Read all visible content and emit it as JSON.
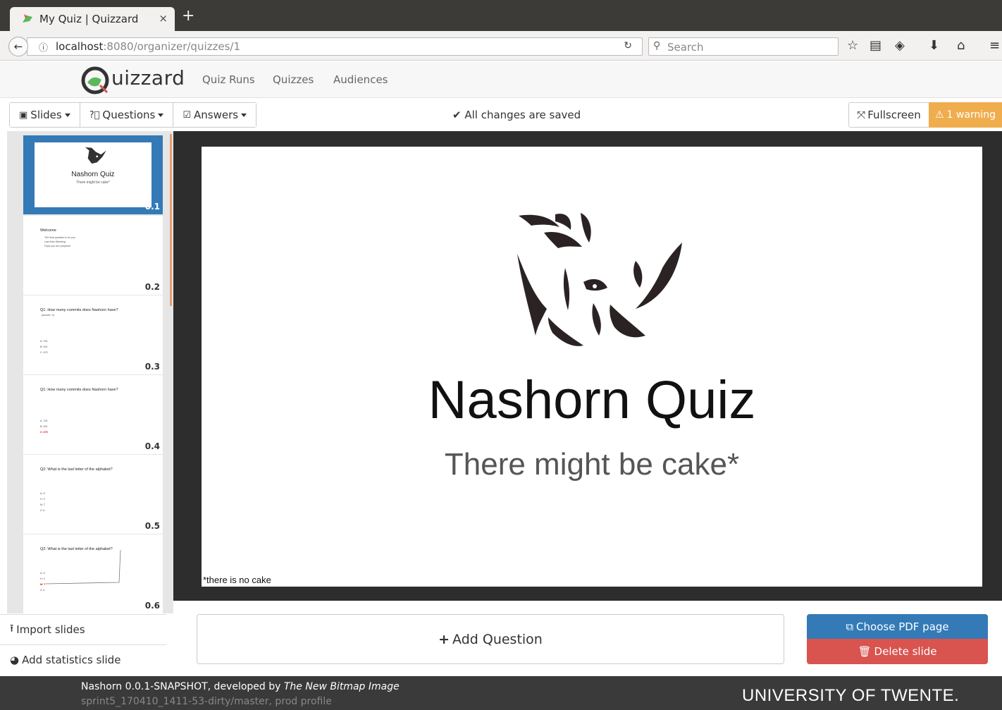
{
  "browser": {
    "tab_title": "My Quiz | Quizzard",
    "tab_close": "×",
    "new_tab": "+",
    "url_host": "localhost",
    "url_rest": ":8080/organizer/quizzes/1",
    "search_placeholder": "Search",
    "icons": [
      "back-icon",
      "info-icon",
      "reload-icon",
      "search-icon",
      "star-icon",
      "reading-list-icon",
      "pocket-icon",
      "download-icon",
      "home-icon",
      "menu-icon"
    ]
  },
  "header": {
    "logo_text": "uizzard",
    "nav": [
      "Quiz Runs",
      "Quizzes",
      "Audiences"
    ]
  },
  "toolbar": {
    "slides_label": "Slides",
    "questions_label": "Questions",
    "answers_label": "Answers",
    "saved_text": "All changes are saved",
    "fullscreen_label": "Fullscreen",
    "warning_label": "1 warning",
    "warning_color": "#f0ad4e"
  },
  "sidebar": {
    "slides": [
      {
        "num": "0.1",
        "title": "Nashorn Quiz",
        "sub": "There might be cake*",
        "active": true
      },
      {
        "num": "0.2",
        "title": "Welcome",
        "lines": [
          "The final question is for you",
          "Last Man Standing",
          "Hope you are prepared"
        ]
      },
      {
        "num": "0.3",
        "title": "Q1: How many commits does Nashorn have?",
        "hint": "(answer: 3)",
        "answers": [
          "A: 726",
          "B: 200",
          "C: 670"
        ]
      },
      {
        "num": "0.4",
        "title": "Q1: How many commits does Nashorn have?",
        "answers": [
          "A: 726",
          "B: 200",
          "C: 670"
        ],
        "correct": "C: 670"
      },
      {
        "num": "0.5",
        "title": "Q2: What is the last letter of the alphabet?",
        "answers": [
          "A: G",
          "H: C",
          "M: T",
          "Z: A"
        ]
      },
      {
        "num": "0.6",
        "title": "Q2: What is the last letter of the alphabet?",
        "answers": [
          "A: G",
          "H: C",
          "M: T",
          "Z: A"
        ],
        "correct": "M: T"
      }
    ],
    "import_label": "Import slides",
    "stats_label": "Add statistics slide"
  },
  "slide": {
    "title": "Nashorn Quiz",
    "subtitle": "There might be cake*",
    "footnote": "*there is no cake"
  },
  "actions": {
    "add_question": "Add Question",
    "choose_pdf": "Choose PDF page",
    "delete_slide": "Delete slide",
    "primary_color": "#337ab7",
    "danger_color": "#d9534f"
  },
  "footer": {
    "version_prefix": "Nashorn 0.0.1-SNAPSHOT, developed by ",
    "developer": "The New Bitmap Image",
    "build": "sprint5_170410_1411-53-dirty/master, prod profile",
    "university": "UNIVERSITY OF TWENTE."
  }
}
